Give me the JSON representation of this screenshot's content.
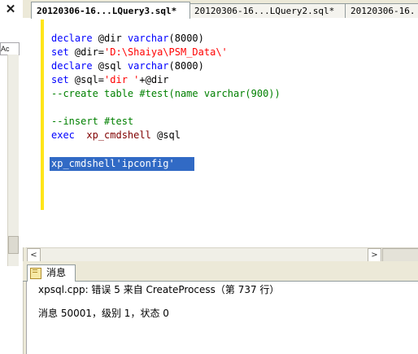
{
  "left_panel": {
    "label": "Ac",
    "close_glyph": "✕"
  },
  "tabs": [
    {
      "label": "20120306-16...LQuery3.sql*",
      "active": true
    },
    {
      "label": "20120306-16...LQuery2.sql*",
      "active": false
    },
    {
      "label": "20120306-16.",
      "active": false
    }
  ],
  "editor": {
    "lines": [
      {
        "segments": [
          {
            "t": "declare",
            "c": "kw"
          },
          {
            "t": " @dir ",
            "c": ""
          },
          {
            "t": "varchar",
            "c": "kw"
          },
          {
            "t": "(8000)",
            "c": ""
          }
        ]
      },
      {
        "segments": [
          {
            "t": "set",
            "c": "kw"
          },
          {
            "t": " @dir=",
            "c": ""
          },
          {
            "t": "'D:\\Shaiya\\PSM_Data\\'",
            "c": "str"
          }
        ]
      },
      {
        "segments": [
          {
            "t": "declare",
            "c": "kw"
          },
          {
            "t": " @sql ",
            "c": ""
          },
          {
            "t": "varchar",
            "c": "kw"
          },
          {
            "t": "(8000)",
            "c": ""
          }
        ]
      },
      {
        "segments": [
          {
            "t": "set",
            "c": "kw"
          },
          {
            "t": " @sql=",
            "c": ""
          },
          {
            "t": "'dir '",
            "c": "str"
          },
          {
            "t": "+@dir",
            "c": ""
          }
        ]
      },
      {
        "segments": [
          {
            "t": "--create table #test(name varchar(900))",
            "c": "cmt"
          }
        ]
      },
      {
        "segments": []
      },
      {
        "segments": [
          {
            "t": "--insert #test",
            "c": "cmt"
          }
        ]
      },
      {
        "segments": [
          {
            "t": "exec",
            "c": "kw"
          },
          {
            "t": "  ",
            "c": ""
          },
          {
            "t": "xp_cmdshell",
            "c": "fn"
          },
          {
            "t": " @sql",
            "c": ""
          }
        ]
      },
      {
        "segments": []
      },
      {
        "segments": [
          {
            "t": "xp_cmdshell'ipconfig'",
            "c": "sel"
          }
        ]
      }
    ]
  },
  "scrollbar": {
    "left_arrow": "<",
    "right_arrow": ">"
  },
  "messages": {
    "tab_label": "消息",
    "lines": [
      "xpsql.cpp: 错误 5 来自 CreateProcess（第 737 行）",
      "消息 50001，级别 1，状态 0"
    ]
  }
}
